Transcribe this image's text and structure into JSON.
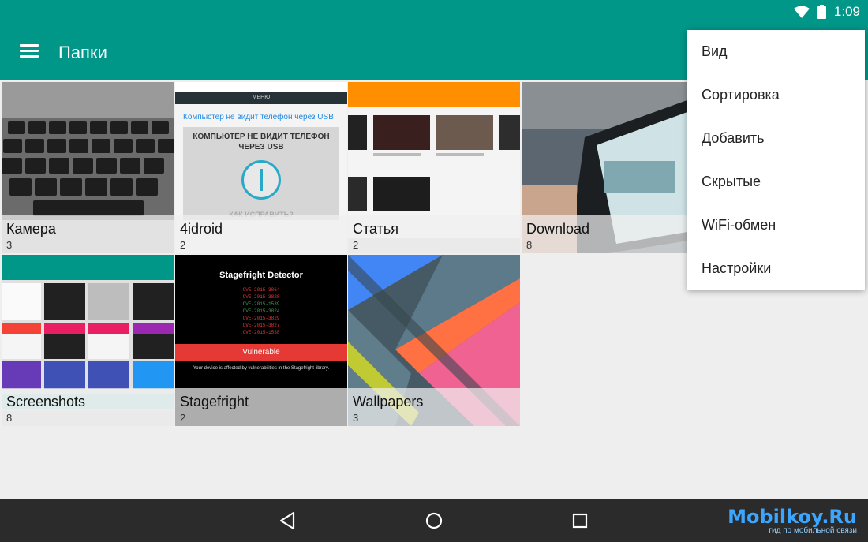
{
  "status": {
    "time": "1:09"
  },
  "toolbar": {
    "title": "Папки"
  },
  "albums": [
    {
      "name": "Камера",
      "count": "3"
    },
    {
      "name": "4idroid",
      "count": "2"
    },
    {
      "name": "Статья",
      "count": "2"
    },
    {
      "name": "Download",
      "count": "8"
    },
    {
      "name": "Screenshots",
      "count": "8"
    },
    {
      "name": "Stagefright",
      "count": "2"
    },
    {
      "name": "Wallpapers",
      "count": "3"
    }
  ],
  "thumb_text": {
    "site_header": "МЕНЮ",
    "article_heading": "Компьютер не видит телефон через USB",
    "banner": "КОМПЬЮТЕР НЕ ВИДИТ ТЕЛЕФОН ЧЕРЕЗ USB",
    "fix": "КАК ИСПРАВИТЬ?",
    "sf_title": "Stagefright Detector",
    "sf_cves": [
      "CVE-2015-3864",
      "CVE-2015-3828",
      "CVE-2015-1539",
      "CVE-2015-3824",
      "CVE-2015-3829",
      "CVE-2015-3827",
      "CVE-2015-1538"
    ],
    "sf_status": "Vulnerable",
    "sf_desc": "Your device is affected by vulnerabilities in the Stagefright library."
  },
  "menu": {
    "items": [
      "Вид",
      "Сортировка",
      "Добавить",
      "Скрытые",
      "WiFi-обмен",
      "Настройки"
    ]
  },
  "watermark": {
    "logo": "Mobilkoy.Ru",
    "tagline": "гид по мобильной связи"
  },
  "colors": {
    "primary": "#009688",
    "navbar": "#2b2b2b"
  }
}
